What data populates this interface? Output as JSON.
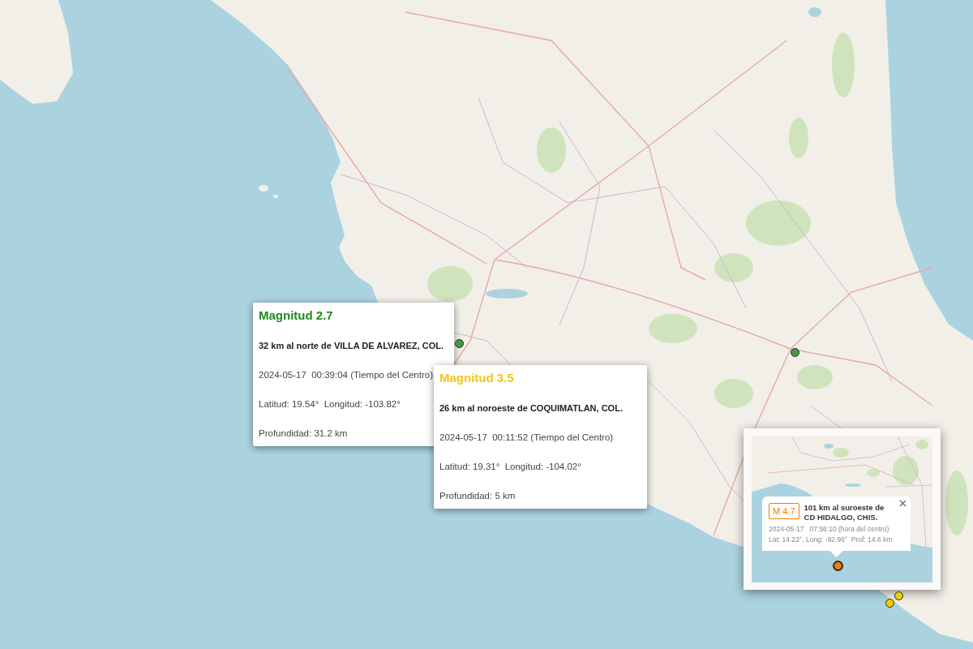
{
  "map": {
    "markers": [
      {
        "color": "#3f9c3f"
      },
      {
        "color": "#3f9c3f"
      },
      {
        "color": "#ecd000"
      },
      {
        "color": "#ecd000"
      }
    ]
  },
  "popups": [
    {
      "title": "Magnitud 2.7",
      "color": "#1f8a1f",
      "place": "32 km al norte de VILLA DE ALVAREZ, COL.",
      "datetime": "2024-05-17  00:39:04 (Tiempo del Centro)",
      "coords": "Latitud: 19.54°  Longitud: -103.82°",
      "depth": "Profundidad: 31.2 km"
    },
    {
      "title": "Magnitud 3.5",
      "color": "#f5c518",
      "place": "26 km al noroeste de COQUIMATLAN, COL.",
      "datetime": "2024-05-17  00:11:52 (Tiempo del Centro)",
      "coords": "Latitud: 19.31°  Longitud: -104.02°",
      "depth": "Profundidad: 5 km"
    }
  ],
  "inset": {
    "badge": "M 4.7",
    "color": "#f57c00",
    "place": "101 km al suroeste de CD HIDALGO, CHIS.",
    "datetime": "2024-05-17   07:56:10 (hora del centro)",
    "details": "Lat: 14.22°, Long: -92.96°  Prof: 14.6 km"
  }
}
